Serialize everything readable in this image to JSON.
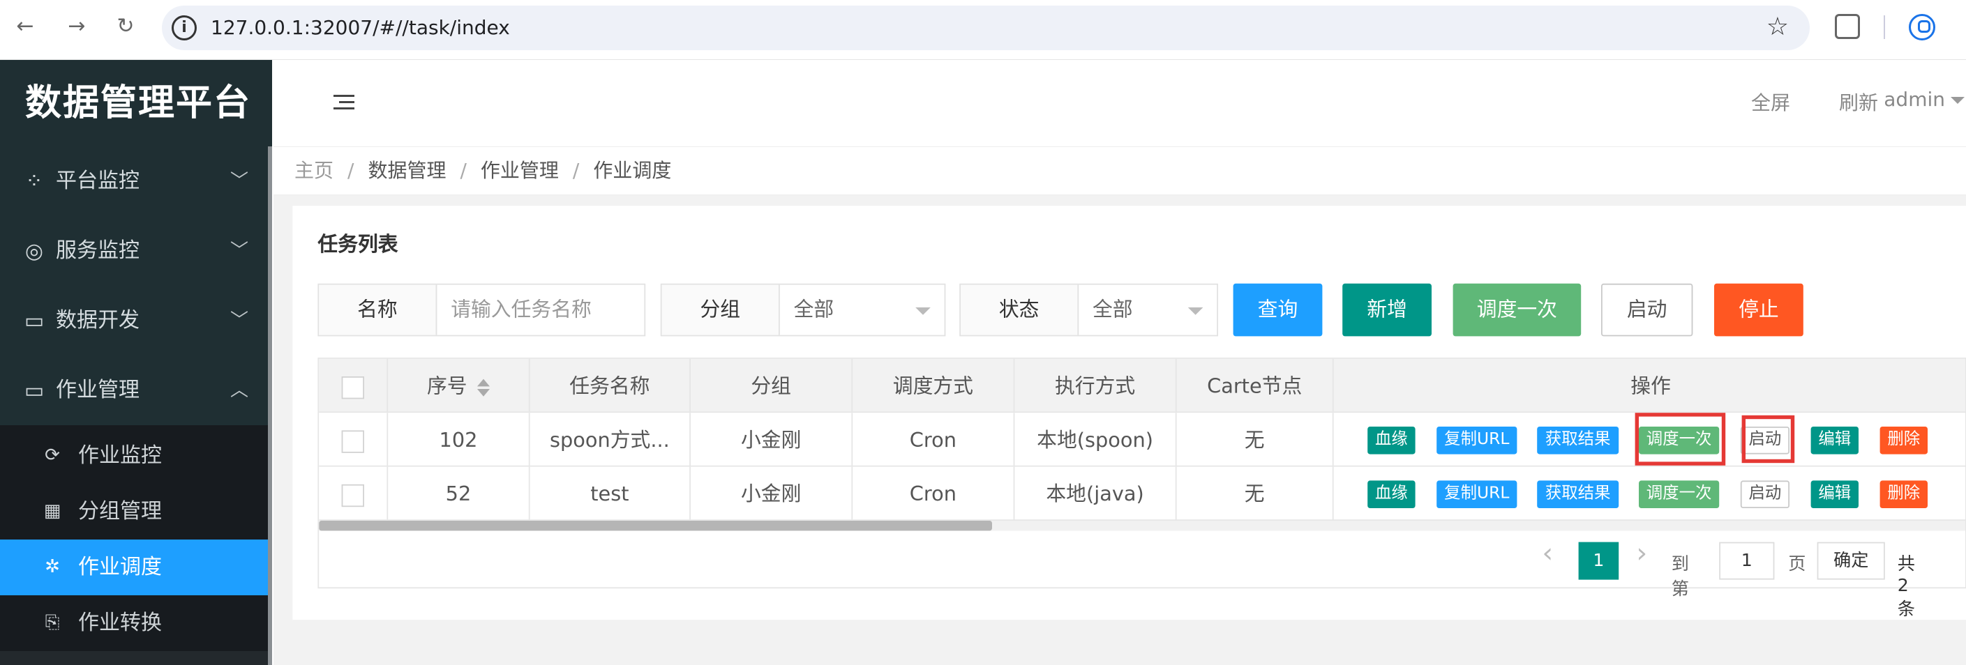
{
  "browser": {
    "url": "127.0.0.1:32007/#//task/index"
  },
  "sidebar": {
    "brand": "数据管理平台",
    "menus": [
      {
        "label": "平台监控",
        "icon": "spinner-icon"
      },
      {
        "label": "服务监控",
        "icon": "lifebuoy-icon"
      },
      {
        "label": "数据开发",
        "icon": "laptop-icon"
      },
      {
        "label": "作业管理",
        "icon": "laptop-icon"
      }
    ],
    "submenu": [
      {
        "label": "作业监控",
        "icon": "refresh-icon"
      },
      {
        "label": "分组管理",
        "icon": "grid-icon"
      },
      {
        "label": "作业调度",
        "icon": "gear-icon"
      },
      {
        "label": "作业转换",
        "icon": "file-code-icon"
      }
    ]
  },
  "header": {
    "fullscreen": "全屏",
    "refresh": "刷新",
    "user": "admin"
  },
  "breadcrumb": [
    "主页",
    "数据管理",
    "作业管理",
    "作业调度"
  ],
  "card_title": "任务列表",
  "search": {
    "name_label": "名称",
    "name_placeholder": "请输入任务名称",
    "group_label": "分组",
    "group_value": "全部",
    "status_label": "状态",
    "status_value": "全部"
  },
  "buttons": {
    "query": "查询",
    "add": "新增",
    "schedule_once": "调度一次",
    "start": "启动",
    "stop": "停止"
  },
  "table": {
    "headers": [
      "序号",
      "任务名称",
      "分组",
      "调度方式",
      "执行方式",
      "Carte节点",
      "操作"
    ],
    "rows": [
      {
        "id": "102",
        "name": "spoon方式...",
        "group": "小金刚",
        "schedule": "Cron",
        "exec": "本地(spoon)",
        "carte": "无"
      },
      {
        "id": "52",
        "name": "test",
        "group": "小金刚",
        "schedule": "Cron",
        "exec": "本地(java)",
        "carte": "无"
      }
    ],
    "ops": {
      "lineage": "血缘",
      "copy_url": "复制URL",
      "get_result": "获取结果",
      "schedule_once": "调度一次",
      "start": "启动",
      "edit": "编辑",
      "delete": "删除"
    }
  },
  "pagination": {
    "current": "1",
    "goto": "到第",
    "page_input": "1",
    "page_unit": "页",
    "confirm": "确定",
    "total": "共 2 条"
  },
  "colors": {
    "sidebar": "#23292d",
    "active": "#1e9fff",
    "teal": "#009688",
    "green": "#5fb878",
    "orange": "#ff5722",
    "highlight": "#e53935"
  }
}
